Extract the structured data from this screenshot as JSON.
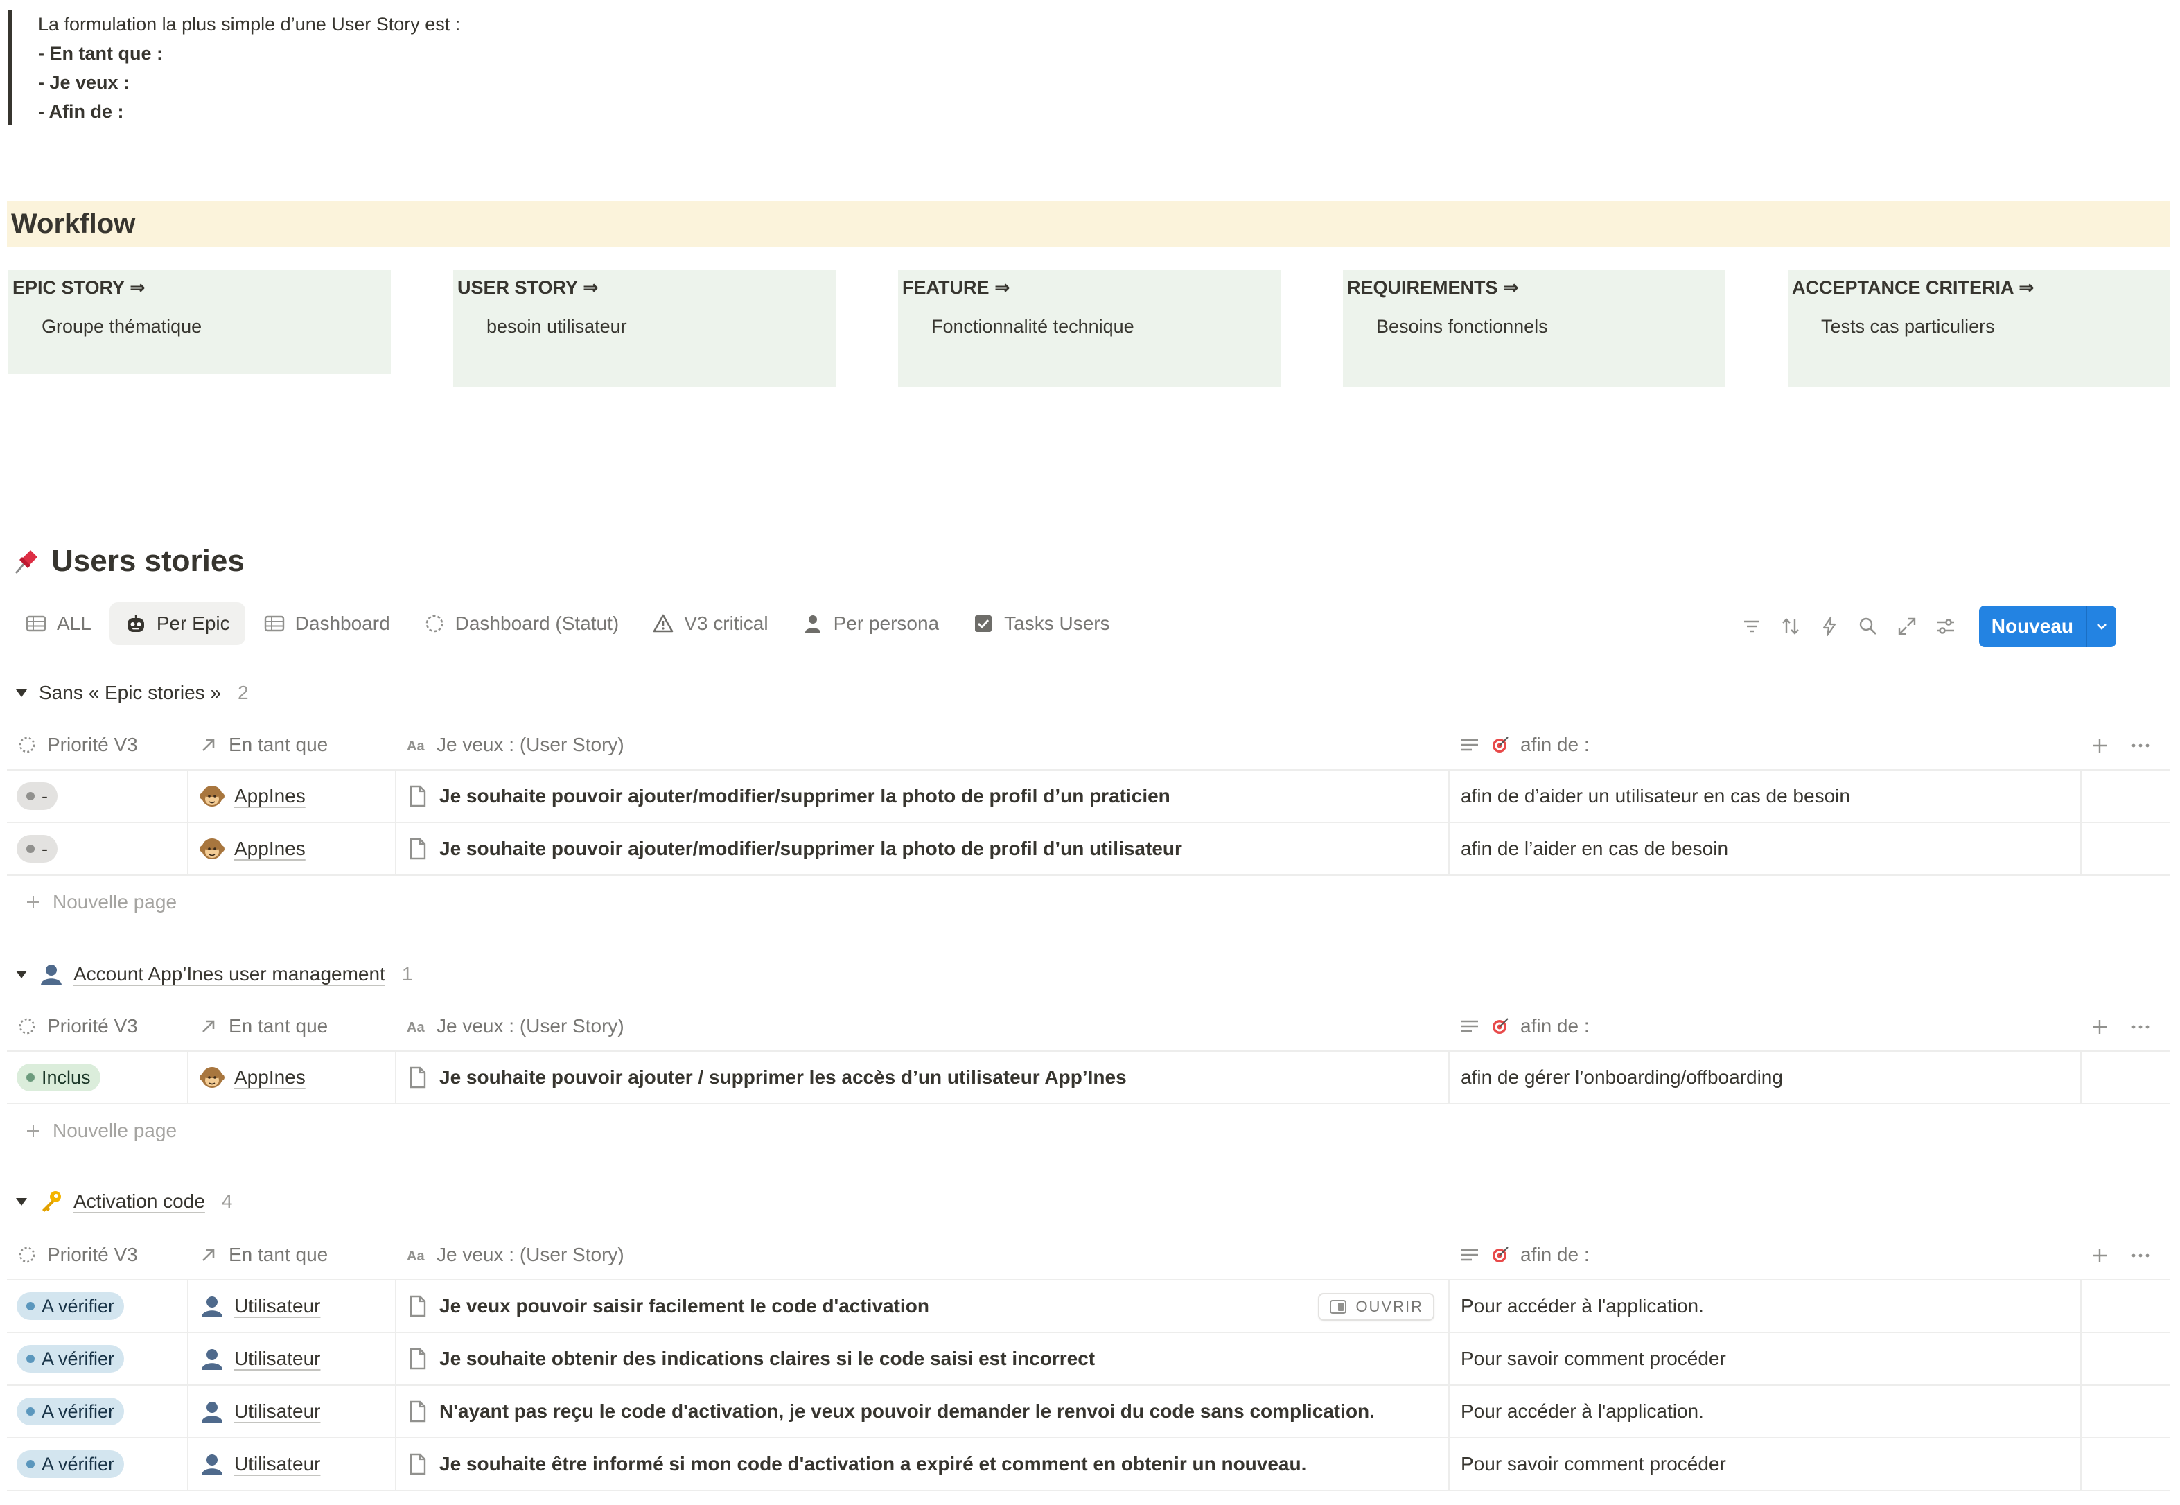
{
  "intro": {
    "line1": "La formulation la plus simple d’une User Story est  :",
    "line2": "- En tant que :",
    "line3": "- Je veux :",
    "line4": "- Afin de :"
  },
  "workflow": {
    "heading": "Workflow",
    "boxes": [
      {
        "title": "EPIC STORY ⇒",
        "desc": "Groupe thématique"
      },
      {
        "title": "USER STORY ⇒",
        "desc": "besoin utilisateur"
      },
      {
        "title": "FEATURE ⇒",
        "desc": "Fonctionnalité technique"
      },
      {
        "title": "REQUIREMENTS ⇒",
        "desc": "Besoins fonctionnels"
      },
      {
        "title": "ACCEPTANCE CRITERIA ⇒",
        "desc": "Tests cas particuliers"
      }
    ]
  },
  "database": {
    "title": "Users stories",
    "title_icon": "pushpin-icon",
    "views": [
      {
        "label": "ALL",
        "icon": "table-icon"
      },
      {
        "label": "Per Epic",
        "icon": "robot-icon"
      },
      {
        "label": "Dashboard",
        "icon": "table-icon"
      },
      {
        "label": "Dashboard (Statut)",
        "icon": "dashed-circle-icon"
      },
      {
        "label": "V3 critical",
        "icon": "warning-triangle-icon"
      },
      {
        "label": "Per persona",
        "icon": "person-icon"
      },
      {
        "label": "Tasks Users",
        "icon": "checkbox-icon"
      }
    ],
    "new_button": "Nouveau",
    "columns": {
      "priority": "Priorité V3",
      "as": "En tant que",
      "want": "Je veux : (User Story)",
      "goal": "afin de :"
    },
    "new_page": "Nouvelle page",
    "open_label": "OUVRIR"
  },
  "groups": [
    {
      "name": "Sans « Epic stories »",
      "count": "2",
      "rows": [
        {
          "priority": "-",
          "as": "AppInes",
          "want": "Je souhaite pouvoir ajouter/modifier/supprimer la photo de profil d’un praticien",
          "goal": "afin de d’aider un utilisateur en cas de besoin"
        },
        {
          "priority": "-",
          "as": "AppInes",
          "want": "Je souhaite pouvoir ajouter/modifier/supprimer la photo de profil d’un utilisateur",
          "goal": "afin de l’aider en cas de besoin"
        }
      ]
    },
    {
      "name": "Account App’Ines user management",
      "count": "1",
      "rows": [
        {
          "priority": "Inclus",
          "as": "AppInes",
          "want": "Je souhaite pouvoir ajouter / supprimer les accès d’un utilisateur App’Ines",
          "goal": "afin de gérer l’onboarding/offboarding"
        }
      ]
    },
    {
      "name": "Activation code",
      "count": "4",
      "rows": [
        {
          "priority": "A vérifier",
          "as": "Utilisateur",
          "want": "Je veux pouvoir saisir facilement le code d'activation",
          "goal": "Pour accéder à l'application."
        },
        {
          "priority": "A vérifier",
          "as": "Utilisateur",
          "want": "Je souhaite obtenir des indications claires si le code saisi est incorrect",
          "goal": "Pour savoir comment procéder"
        },
        {
          "priority": "A vérifier",
          "as": "Utilisateur",
          "want": "N'ayant pas reçu le code d'activation, je veux pouvoir demander le renvoi du code sans complication.",
          "goal": "Pour accéder à l'application."
        },
        {
          "priority": "A vérifier",
          "as": "Utilisateur",
          "want": "Je souhaite être informé si mon code d'activation a expiré et comment en obtenir un nouveau.",
          "goal": "Pour savoir comment procéder"
        }
      ]
    }
  ],
  "colors": {
    "accent": "#2383e2",
    "workflow_heading_bg": "#fbf3db",
    "workflow_box_bg": "#edf3ec",
    "pill_gray": "#e3e2e0",
    "pill_green": "#dbeddb",
    "pill_blue": "#d3e5ef"
  }
}
